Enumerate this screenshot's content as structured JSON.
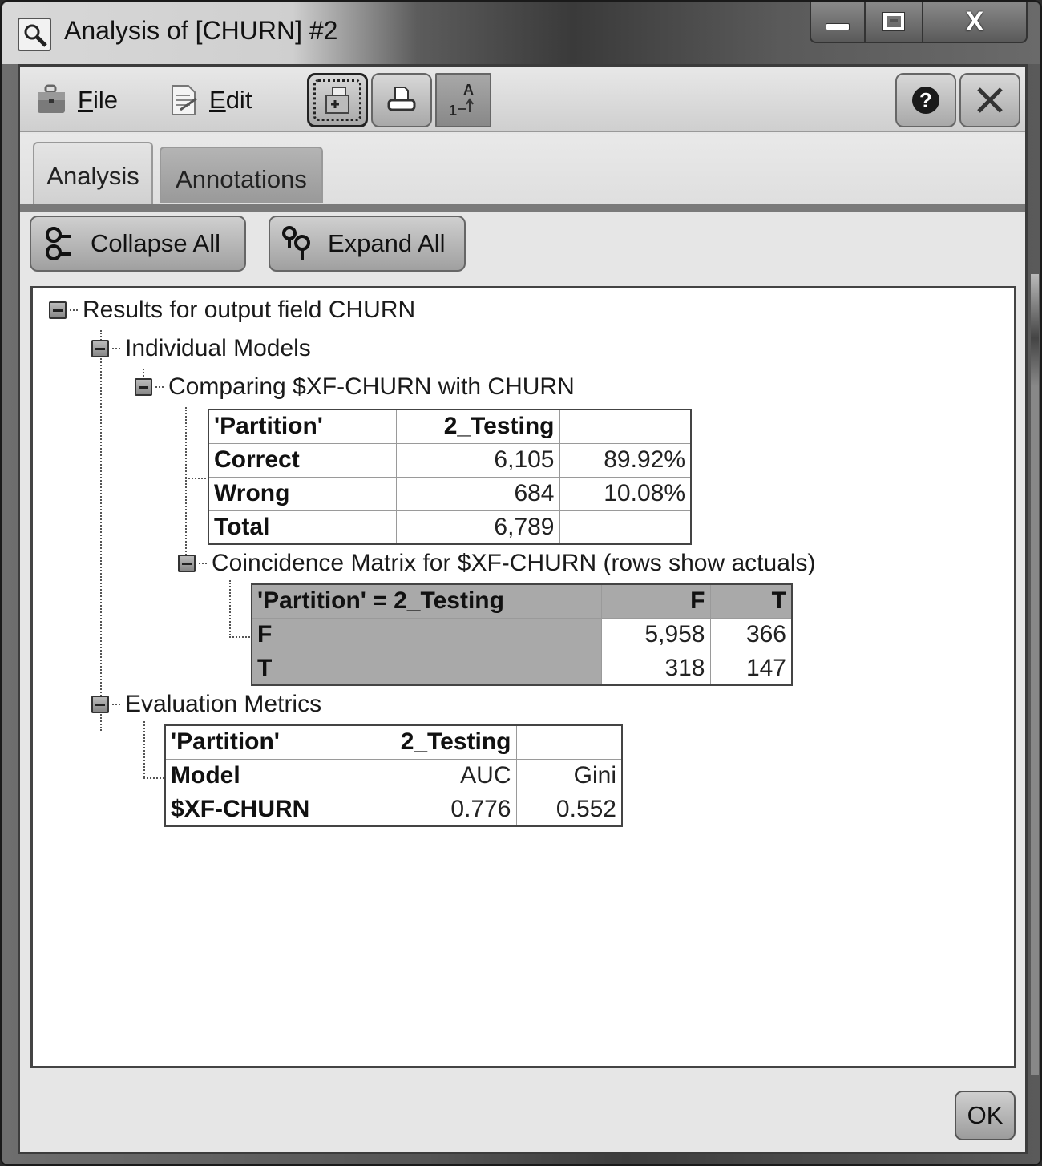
{
  "window": {
    "title": "Analysis of [CHURN] #2",
    "caption_buttons": {
      "minimize": "minimize",
      "maximize": "maximize",
      "close": "X"
    }
  },
  "menubar": {
    "file_label": "File",
    "edit_label": "Edit",
    "tools": [
      "copy-to-clipboard-icon",
      "print-icon",
      "sort-order-icon"
    ],
    "help_glyph": "?",
    "close_glyph": "✕"
  },
  "tabs": [
    {
      "label": "Analysis",
      "active": true
    },
    {
      "label": "Annotations",
      "active": false
    }
  ],
  "actions": {
    "collapse_all": "Collapse All",
    "expand_all": "Expand All"
  },
  "tree": {
    "root": "Results for output field CHURN",
    "individual_models": "Individual Models",
    "comparing": "Comparing $XF-CHURN with CHURN",
    "coincidence": "Coincidence Matrix for $XF-CHURN (rows show actuals)",
    "evaluation": "Evaluation Metrics"
  },
  "comparison_table": {
    "header": [
      "'Partition'",
      "2_Testing",
      ""
    ],
    "rows": [
      [
        "Correct",
        "6,105",
        "89.92%"
      ],
      [
        "Wrong",
        "684",
        "10.08%"
      ],
      [
        "Total",
        "6,789",
        ""
      ]
    ]
  },
  "coincidence_matrix": {
    "header": [
      "'Partition' = 2_Testing",
      "F",
      "T"
    ],
    "rows": [
      [
        "F",
        "5,958",
        "366"
      ],
      [
        "T",
        "318",
        "147"
      ]
    ]
  },
  "evaluation_table": {
    "header": [
      "'Partition'",
      "2_Testing",
      ""
    ],
    "rows": [
      [
        "Model",
        "AUC",
        "Gini"
      ],
      [
        "$XF-CHURN",
        "0.776",
        "0.552"
      ]
    ]
  },
  "footer": {
    "ok_label": "OK"
  }
}
